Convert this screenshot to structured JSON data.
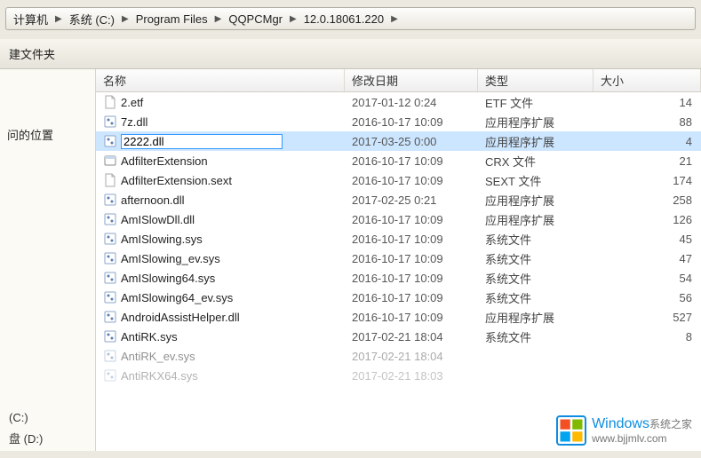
{
  "breadcrumb": [
    {
      "label": "计算机"
    },
    {
      "label": "系统 (C:)"
    },
    {
      "label": "Program Files"
    },
    {
      "label": "QQPCMgr"
    },
    {
      "label": "12.0.18061.220"
    }
  ],
  "toolbar": {
    "new_folder": "建文件夹"
  },
  "sidebar": {
    "recent": "问的位置",
    "drive_c": "(C:)",
    "drive_d": "盘 (D:)"
  },
  "columns": {
    "name": "名称",
    "date": "修改日期",
    "type": "类型",
    "size": "大小"
  },
  "editing_filename": "2222.dll",
  "files": [
    {
      "name": "2.etf",
      "date": "2017-01-12 0:24",
      "type": "ETF 文件",
      "size": "14",
      "icon": "file"
    },
    {
      "name": "7z.dll",
      "date": "2016-10-17 10:09",
      "type": "应用程序扩展",
      "size": "88",
      "icon": "dll"
    },
    {
      "name": "2222.dll",
      "date": "2017-03-25 0:00",
      "type": "应用程序扩展",
      "size": "4",
      "icon": "dll",
      "editing": true
    },
    {
      "name": "AdfilterExtension",
      "date": "2016-10-17 10:09",
      "type": "CRX 文件",
      "size": "21",
      "icon": "crx"
    },
    {
      "name": "AdfilterExtension.sext",
      "date": "2016-10-17 10:09",
      "type": "SEXT 文件",
      "size": "174",
      "icon": "file"
    },
    {
      "name": "afternoon.dll",
      "date": "2017-02-25 0:21",
      "type": "应用程序扩展",
      "size": "258",
      "icon": "dll"
    },
    {
      "name": "AmISlowDll.dll",
      "date": "2016-10-17 10:09",
      "type": "应用程序扩展",
      "size": "126",
      "icon": "dll"
    },
    {
      "name": "AmISlowing.sys",
      "date": "2016-10-17 10:09",
      "type": "系统文件",
      "size": "45",
      "icon": "sys"
    },
    {
      "name": "AmISlowing_ev.sys",
      "date": "2016-10-17 10:09",
      "type": "系统文件",
      "size": "47",
      "icon": "sys"
    },
    {
      "name": "AmISlowing64.sys",
      "date": "2016-10-17 10:09",
      "type": "系统文件",
      "size": "54",
      "icon": "sys"
    },
    {
      "name": "AmISlowing64_ev.sys",
      "date": "2016-10-17 10:09",
      "type": "系统文件",
      "size": "56",
      "icon": "sys"
    },
    {
      "name": "AndroidAssistHelper.dll",
      "date": "2016-10-17 10:09",
      "type": "应用程序扩展",
      "size": "527",
      "icon": "dll"
    },
    {
      "name": "AntiRK.sys",
      "date": "2017-02-21 18:04",
      "type": "系统文件",
      "size": "8",
      "icon": "sys"
    },
    {
      "name": "AntiRK_ev.sys",
      "date": "2017-02-21 18:04",
      "type": "",
      "size": "",
      "icon": "sys",
      "fade": 1
    },
    {
      "name": "AntiRKX64.sys",
      "date": "2017-02-21 18:03",
      "type": "",
      "size": "",
      "icon": "sys",
      "fade": 2
    }
  ],
  "watermark": {
    "brand": "Windows",
    "sub": "系统之家",
    "url": "www.bjjmlv.com"
  }
}
